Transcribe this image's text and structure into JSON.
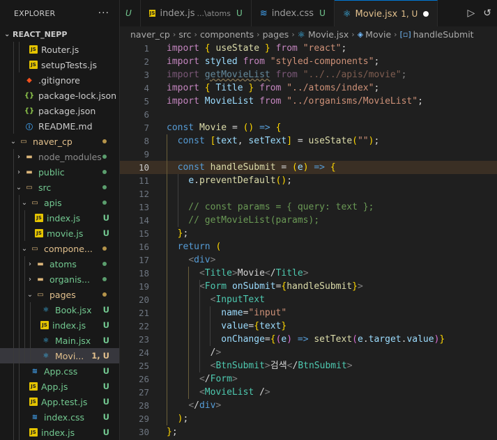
{
  "explorer": {
    "title": "EXPLORER",
    "more": "···",
    "root": "REACT_NEPP"
  },
  "tree": [
    {
      "label": "Router.js",
      "icon": "js-file-icon",
      "status": ""
    },
    {
      "label": "setupTests.js",
      "icon": "js-file-icon",
      "status": ""
    },
    {
      "label": ".gitignore",
      "icon": "git-file-icon",
      "status": ""
    },
    {
      "label": "package-lock.json",
      "icon": "json-file-icon",
      "status": ""
    },
    {
      "label": "package.json",
      "icon": "json-file-icon",
      "status": ""
    },
    {
      "label": "README.md",
      "icon": "info-file-icon",
      "status": ""
    },
    {
      "label": "naver_cp",
      "icon": "folder-open-icon",
      "status": "dot-yellow"
    },
    {
      "label": "node_modules",
      "icon": "folder-icon",
      "status": "dot-green"
    },
    {
      "label": "public",
      "icon": "folder-icon",
      "status": "dot-green"
    },
    {
      "label": "src",
      "icon": "folder-open-icon",
      "status": "dot-green"
    },
    {
      "label": "apis",
      "icon": "folder-open-icon",
      "status": "dot-green"
    },
    {
      "label": "index.js",
      "icon": "js-file-icon",
      "status": "U"
    },
    {
      "label": "movie.js",
      "icon": "js-file-icon",
      "status": "U"
    },
    {
      "label": "compone...",
      "icon": "folder-open-icon",
      "status": "dot-yellow"
    },
    {
      "label": "atoms",
      "icon": "folder-icon",
      "status": "dot-green"
    },
    {
      "label": "organis...",
      "icon": "folder-icon",
      "status": "dot-green"
    },
    {
      "label": "pages",
      "icon": "folder-open-icon",
      "status": "dot-yellow"
    },
    {
      "label": "Book.jsx",
      "icon": "react-file-icon",
      "status": "U"
    },
    {
      "label": "index.js",
      "icon": "js-file-icon",
      "status": "U"
    },
    {
      "label": "Main.jsx",
      "icon": "react-file-icon",
      "status": "U"
    },
    {
      "label": "Movi...",
      "icon": "react-file-icon",
      "status": "1, U"
    },
    {
      "label": "App.css",
      "icon": "css-file-icon",
      "status": "U"
    },
    {
      "label": "App.js",
      "icon": "js-file-icon",
      "status": "U"
    },
    {
      "label": "App.test.js",
      "icon": "js-file-icon",
      "status": "U"
    },
    {
      "label": "index.css",
      "icon": "css-file-icon",
      "status": "U"
    },
    {
      "label": "index.js",
      "icon": "js-file-icon",
      "status": "U"
    }
  ],
  "tabs": [
    {
      "label": "",
      "desc": "",
      "flag": "U",
      "icon": ""
    },
    {
      "label": "index.js",
      "desc": "...\\atoms",
      "flag": "U",
      "icon": "JS"
    },
    {
      "label": "index.css",
      "desc": "",
      "flag": "U",
      "icon": "≋"
    },
    {
      "label": "Movie.jsx",
      "desc": "",
      "flag": "1, U",
      "icon": "⚛"
    }
  ],
  "breadcrumb": [
    "naver_cp",
    "src",
    "components",
    "pages",
    "Movie.jsx",
    "Movie",
    "handleSubmit"
  ],
  "code_lines": [
    "import { useState } from \"react\";",
    "import styled from \"styled-components\";",
    "import getMovieList from \"../../apis/movie\";",
    "import { Title } from \"../atoms/index\";",
    "import MovieList from \"../organisms/MovieList\";",
    "",
    "const Movie = () => {",
    "  const [text, setText] = useState(\"\");",
    "",
    "  const handleSubmit = (e) => {",
    "    e.preventDefault();",
    "",
    "    // const params = { query: text };",
    "    // getMovieList(params);",
    "  };",
    "  return (",
    "    <div>",
    "      <Title>Movie</Title>",
    "      <Form onSubmit={handleSubmit}>",
    "        <InputText",
    "          name=\"input\"",
    "          value={text}",
    "          onChange={(e) => setText(e.target.value)}",
    "        />",
    "        <BtnSubmit>검색</BtnSubmit>",
    "      </Form>",
    "      <MovieList />",
    "    </div>",
    "  );",
    "};"
  ]
}
